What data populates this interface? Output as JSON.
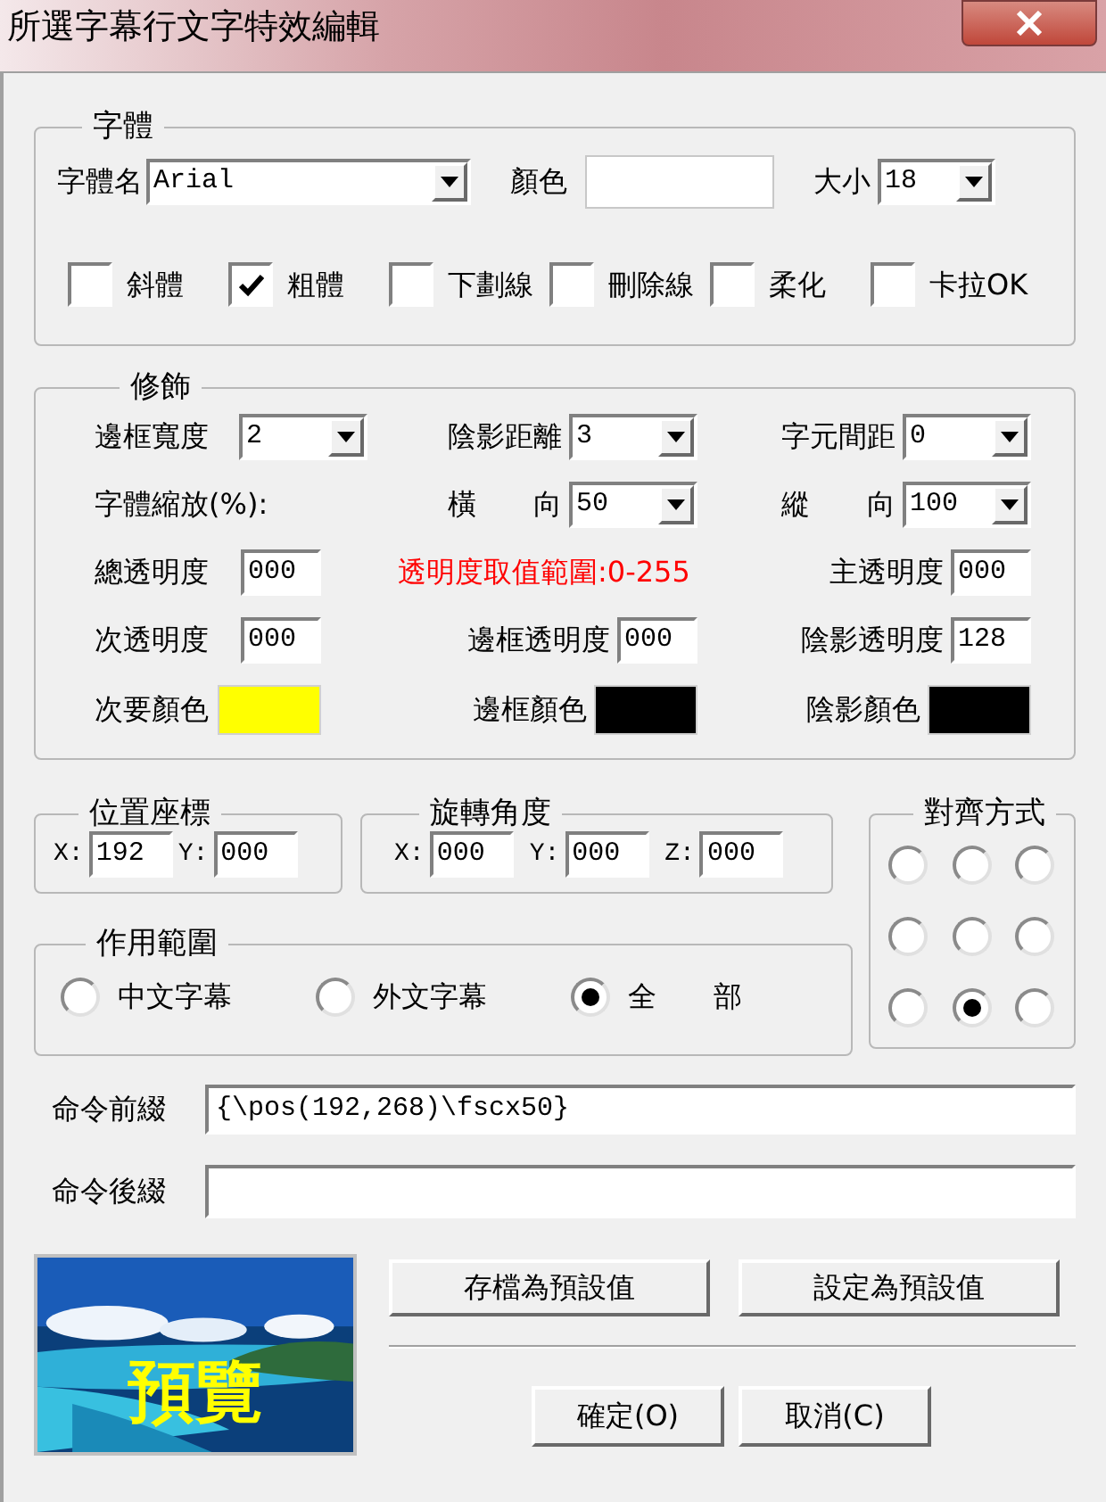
{
  "window": {
    "title": "所選字幕行文字特效編輯"
  },
  "font_group": {
    "title": "字體",
    "name_label": "字體名",
    "name_value": "Arial",
    "color_label": "顏色",
    "color": "#ffffff",
    "size_label": "大小",
    "size_value": "18",
    "styles": [
      {
        "label": "斜體",
        "checked": false
      },
      {
        "label": "粗體",
        "checked": true
      },
      {
        "label": "下劃線",
        "checked": false
      },
      {
        "label": "刪除線",
        "checked": false
      },
      {
        "label": "柔化",
        "checked": false
      },
      {
        "label": "卡拉OK",
        "checked": false
      }
    ]
  },
  "decoration": {
    "title": "修飾",
    "rows": [
      [
        {
          "kind": "dropdown",
          "label": "邊框寬度",
          "value": "2"
        },
        {
          "kind": "dropdown",
          "label": "陰影距離",
          "value": "3"
        },
        {
          "kind": "dropdown",
          "label": "字元間距",
          "value": "0"
        }
      ],
      [
        {
          "kind": "label",
          "label": "字體縮放(%):"
        },
        {
          "kind": "dropdown",
          "label": "橫　　向",
          "value": "50"
        },
        {
          "kind": "dropdown",
          "label": "縱　　向",
          "value": "100"
        }
      ],
      [
        {
          "kind": "field",
          "label": "總透明度",
          "value": "000"
        },
        {
          "kind": "note",
          "label": "透明度取值範圍:0-255"
        },
        {
          "kind": "field",
          "label": "主透明度",
          "value": "000"
        }
      ],
      [
        {
          "kind": "field",
          "label": "次透明度",
          "value": "000"
        },
        {
          "kind": "field",
          "label": "邊框透明度",
          "value": "000"
        },
        {
          "kind": "field",
          "label": "陰影透明度",
          "value": "128"
        }
      ],
      [
        {
          "kind": "swatch",
          "label": "次要顏色",
          "color": "#ffff00"
        },
        {
          "kind": "swatch",
          "label": "邊框顏色",
          "color": "#000000"
        },
        {
          "kind": "swatch",
          "label": "陰影顏色",
          "color": "#000000"
        }
      ]
    ]
  },
  "position": {
    "title": "位置座標",
    "fields": [
      {
        "label": "X:",
        "value": "192"
      },
      {
        "label": "Y:",
        "value": "000"
      }
    ]
  },
  "rotation": {
    "title": "旋轉角度",
    "fields": [
      {
        "label": "X:",
        "value": "000"
      },
      {
        "label": "Y:",
        "value": "000"
      },
      {
        "label": "Z:",
        "value": "000"
      }
    ]
  },
  "scope": {
    "title": "作用範圍",
    "options": [
      {
        "label": "中文字幕",
        "selected": false
      },
      {
        "label": "外文字幕",
        "selected": false
      },
      {
        "label": "全　　部",
        "selected": true
      }
    ]
  },
  "alignment": {
    "title": "對齊方式",
    "options": [
      {
        "selected": false
      },
      {
        "selected": false
      },
      {
        "selected": false
      },
      {
        "selected": false
      },
      {
        "selected": false
      },
      {
        "selected": false
      },
      {
        "selected": false
      },
      {
        "selected": true
      },
      {
        "selected": false
      }
    ]
  },
  "command_prefix": {
    "label": "命令前綴",
    "value": "{\\pos(192,268)\\fscx50}"
  },
  "command_suffix": {
    "label": "命令後綴"
  },
  "preview": {
    "label": "預覽"
  },
  "buttons": {
    "save_default": "存檔為預設值",
    "set_default": "設定為預設值",
    "ok": "確定(O)",
    "cancel": "取消(C)"
  }
}
